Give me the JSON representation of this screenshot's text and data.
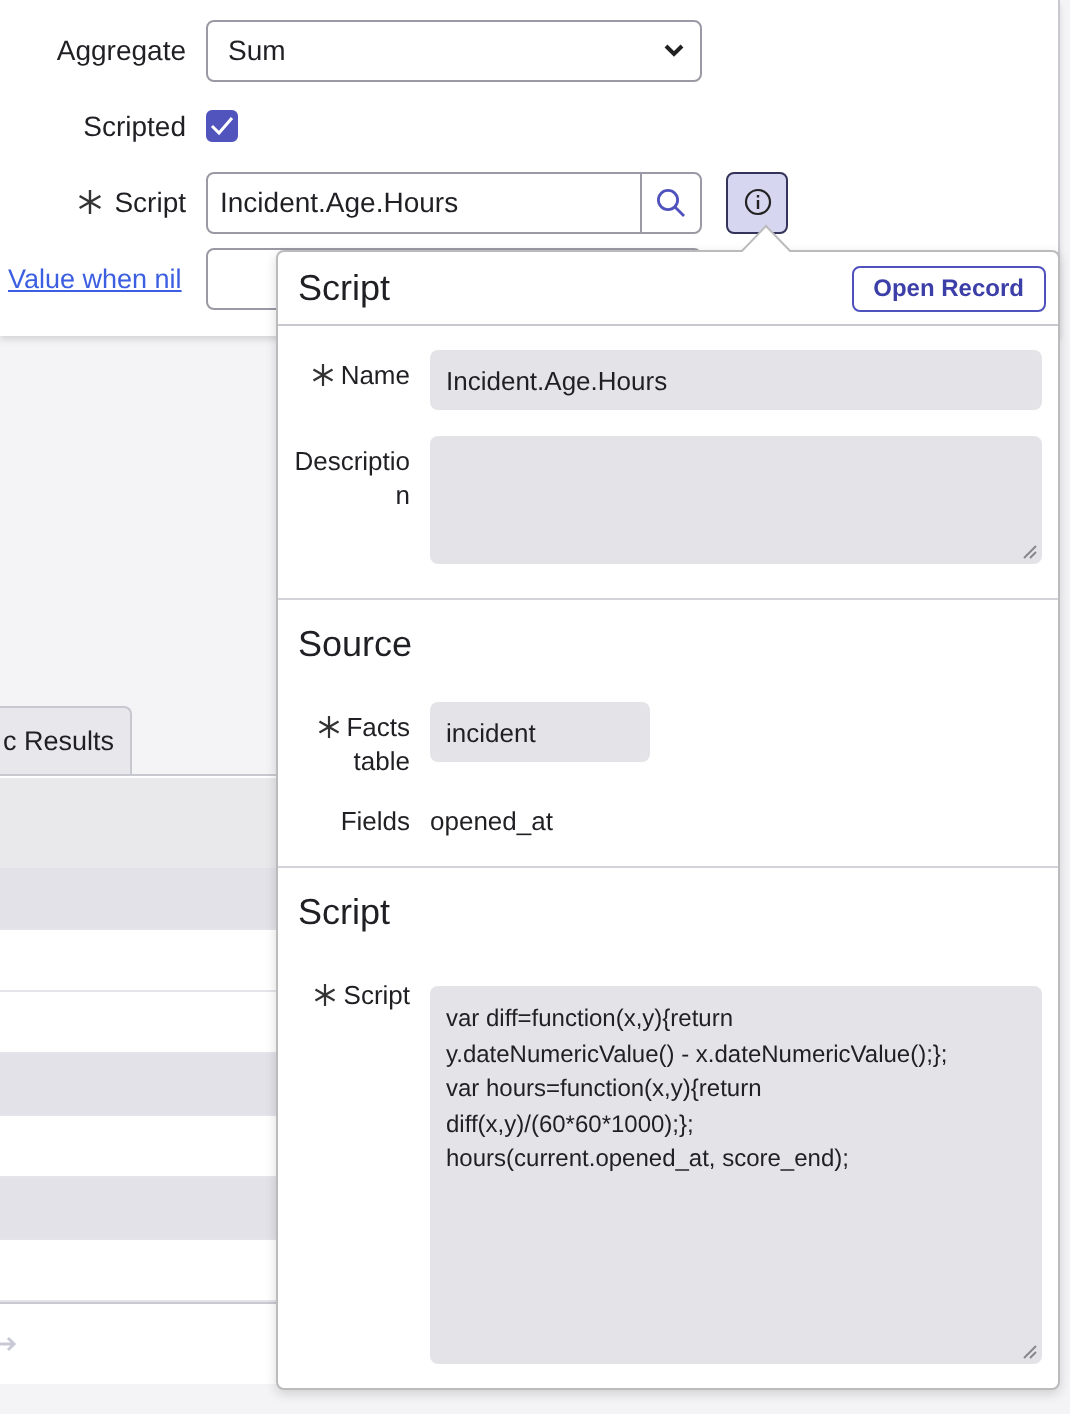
{
  "form": {
    "aggregate": {
      "label": "Aggregate",
      "value": "Sum"
    },
    "scripted": {
      "label": "Scripted",
      "checked": true
    },
    "script": {
      "label": "Script",
      "required": true,
      "value": "Incident.Age.Hours"
    },
    "value_when_nil": {
      "label": "Value when nil"
    }
  },
  "tabs": [
    {
      "label": "c Results",
      "selected": false
    }
  ],
  "table": {
    "rows": [
      {
        "shaded": true
      },
      {
        "shaded": false
      },
      {
        "shaded": false
      },
      {
        "shaded": true
      },
      {
        "shaded": false
      },
      {
        "shaded": true
      },
      {
        "shaded": false
      }
    ]
  },
  "popover": {
    "title": "Script",
    "button": "Open Record",
    "fields": [
      {
        "label": "Name",
        "required": true,
        "kind": "input",
        "value": "Incident.Age.Hours"
      },
      {
        "label": "Description",
        "required": false,
        "kind": "textarea"
      }
    ],
    "sections": [
      {
        "title": "Source",
        "fields": [
          {
            "label": "Facts table",
            "required": true,
            "kind": "input",
            "value": "incident"
          },
          {
            "label": "Fields",
            "required": false,
            "kind": "text",
            "value": "opened_at"
          }
        ]
      },
      {
        "title": "Script",
        "fields": [
          {
            "label": "Script",
            "required": true,
            "kind": "code",
            "lines": [
              "var diff=function(x,y){return",
              "y.dateNumericValue() - x.dateNumericValue();};",
              "var hours=function(x,y){return",
              "diff(x,y)/(60*60*1000);};",
              "hours(current.opened_at, score_end);"
            ]
          }
        ]
      }
    ]
  }
}
